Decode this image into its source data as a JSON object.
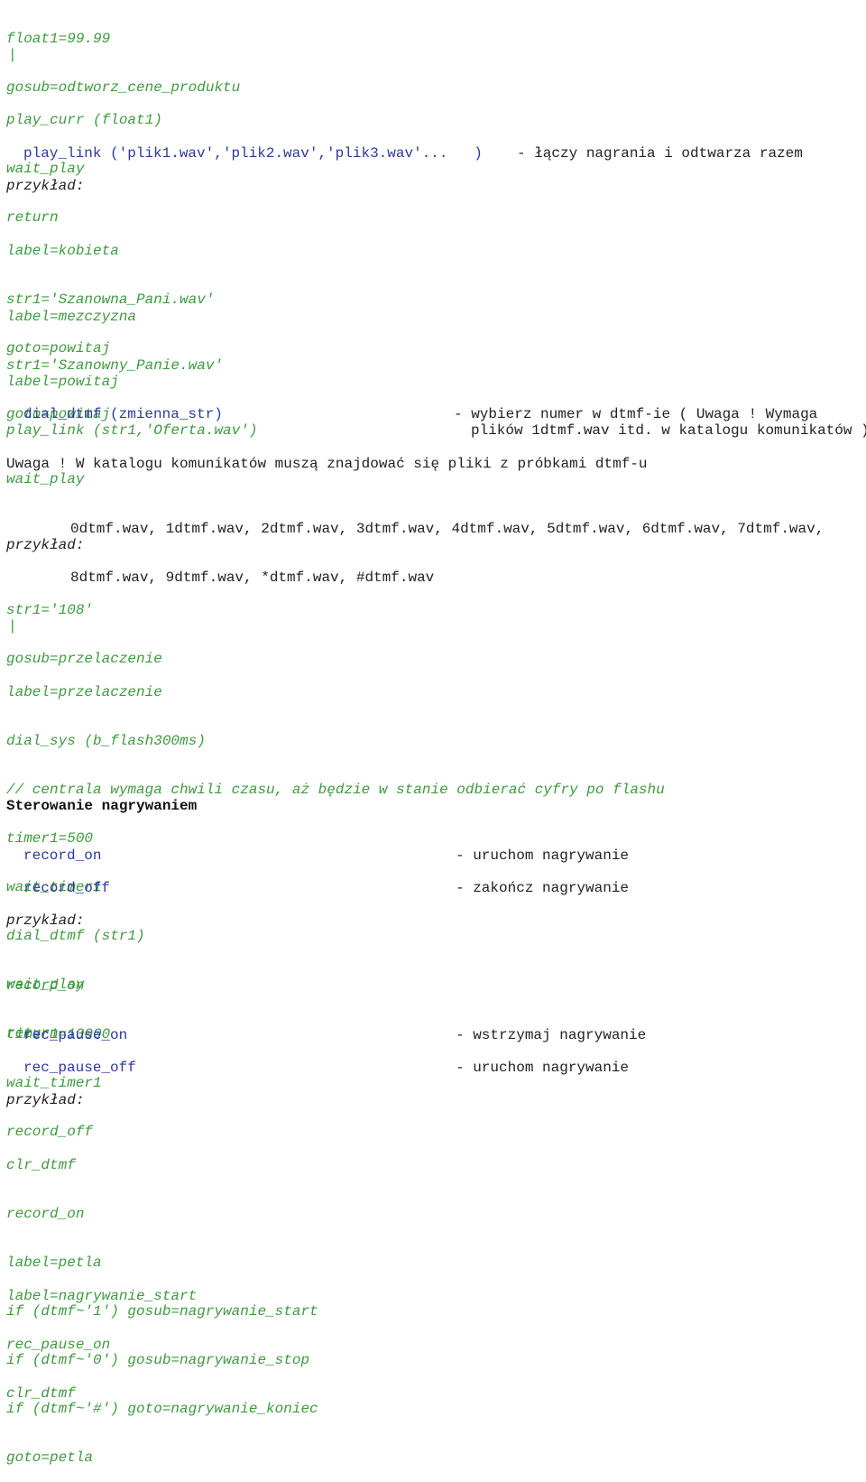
{
  "colors": {
    "code": "#3f9a3f",
    "command": "#2b3a9a",
    "text": "#222222"
  },
  "b1": [
    "float1=99.99",
    "gosub=odtworz_cene_produktu"
  ],
  "pipe": "|",
  "b2": [
    "play_curr (float1)",
    "wait_play",
    "return"
  ],
  "play_link": {
    "cmd": "play_link ('plik1.wav','plik2.wav','plik3.wav'...   )",
    "desc": "- łączy nagrania i odtwarza razem"
  },
  "example_label": "przykład:",
  "b3": [
    "label=kobieta",
    "str1='Szanowna_Pani.wav'",
    "goto=powitaj"
  ],
  "b4": [
    "label=mezczyzna",
    "str1='Szanowny_Panie.wav'",
    "goto=powitaj"
  ],
  "b5": [
    "label=powitaj",
    "play_link (str1,'Oferta.wav')",
    "wait_play"
  ],
  "dial_dtmf": {
    "cmd": "dial_dtmf (zmienna_str)",
    "desc": [
      "- wybierz numer w dtmf-ie ( Uwaga ! Wymaga",
      "plików 1dtmf.wav itd. w katalogu komunikatów )"
    ]
  },
  "note": "Uwaga ! W katalogu komunikatów muszą znajdować się pliki z próbkami dtmf-u",
  "files": [
    "0dtmf.wav, 1dtmf.wav, 2dtmf.wav, 3dtmf.wav, 4dtmf.wav, 5dtmf.wav, 6dtmf.wav, 7dtmf.wav,",
    "8dtmf.wav, 9dtmf.wav, *dtmf.wav, #dtmf.wav"
  ],
  "b6": [
    "str1='108'",
    "gosub=przelaczenie"
  ],
  "b7": [
    "label=przelaczenie",
    "dial_sys (b_flash300ms)",
    "// centrala wymaga chwili czasu, aż będzie w stanie odbierać cyfry po flashu",
    "timer1=500",
    "wait_timer1",
    "dial_dtmf (str1)",
    "wait_play",
    "return"
  ],
  "section_title": "Sterowanie nagrywaniem",
  "rec": [
    {
      "cmd": "record_on",
      "desc": "- uruchom nagrywanie"
    },
    {
      "cmd": "record_off",
      "desc": "- zakończ nagrywanie"
    },
    {
      "cmd": "rec_pause_on",
      "desc": "- wstrzymaj nagrywanie"
    },
    {
      "cmd": "rec_pause_off",
      "desc": "- uruchom nagrywanie"
    }
  ],
  "b8": [
    "record_on",
    "timer1=10000",
    "wait_timer1",
    "record_off"
  ],
  "b9": [
    "clr_dtmf",
    "record_on",
    "label=petla",
    "if (dtmf~'1') gosub=nagrywanie_start",
    "if (dtmf~'0') gosub=nagrywanie_stop",
    "if (dtmf~'#') goto=nagrywanie_koniec",
    "goto=petla"
  ],
  "b10": [
    "label=nagrywanie_start",
    "rec_pause_on",
    "clr_dtmf"
  ]
}
